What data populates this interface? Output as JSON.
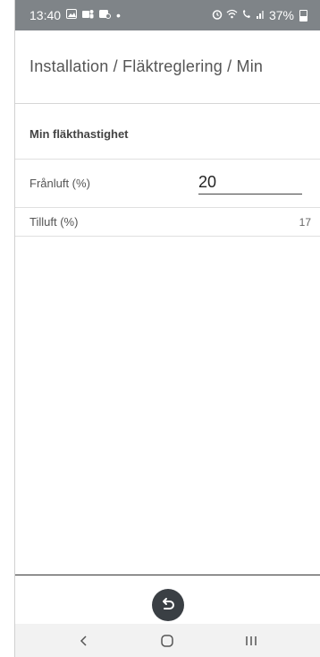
{
  "status_bar": {
    "time": "13:40",
    "dot": "•",
    "battery_percent": "37%"
  },
  "header": {
    "breadcrumb": "Installation / Fläktreglering / Min"
  },
  "section": {
    "title": "Min fläkthastighet"
  },
  "fields": {
    "franluft": {
      "label": "Frånluft (%)",
      "value": "20"
    },
    "tilluft": {
      "label": "Tilluft (%)",
      "value": "17"
    }
  },
  "colors": {
    "status_bar_bg": "#7f8488",
    "back_button_bg": "#3a3f44",
    "navbar_bg": "#f2f2f2"
  },
  "icons": {
    "back_button": "undo-arrow-icon",
    "nav_back": "chevron-left-icon",
    "nav_home": "home-icon",
    "nav_recents": "recents-icon"
  }
}
